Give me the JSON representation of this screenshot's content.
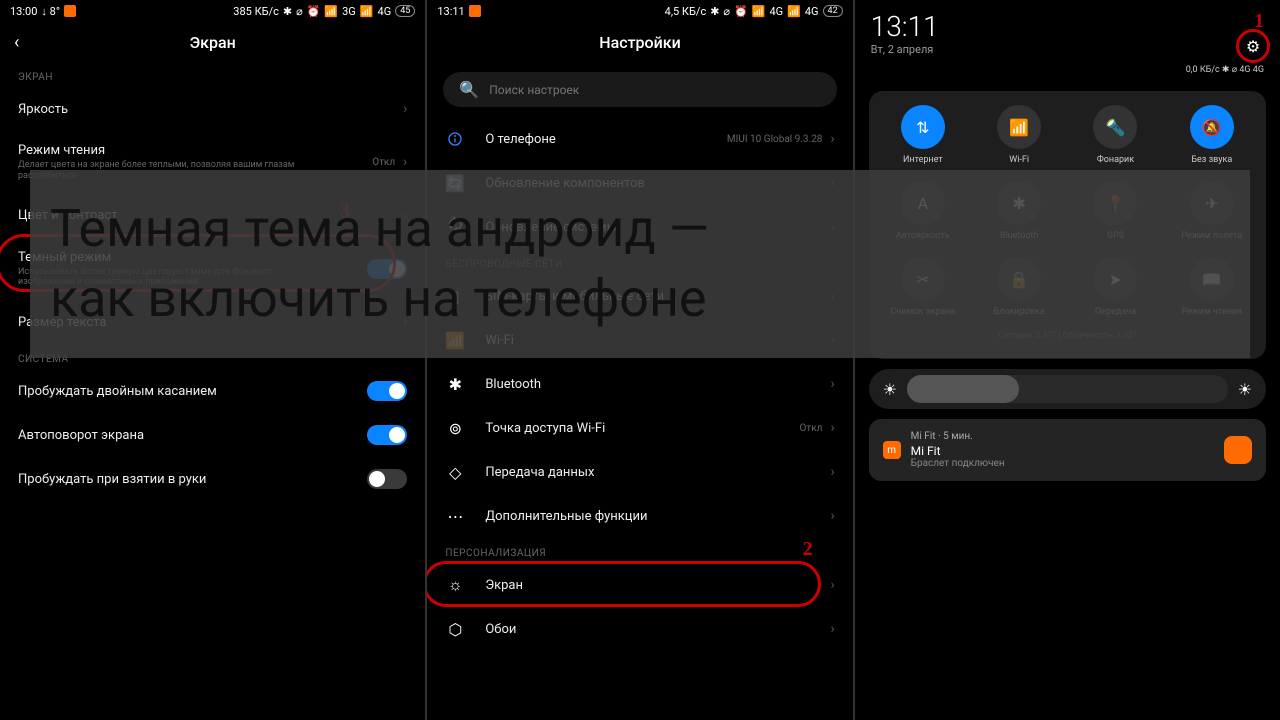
{
  "overlay": {
    "line1": "Темная тема на андроид —",
    "line2": "как включить на телефоне"
  },
  "annotations": {
    "n1": "1",
    "n2": "2",
    "n3": "3"
  },
  "panel1": {
    "status": {
      "time": "13:00",
      "temp": "↓ 8°",
      "speed": "385 КБ/с",
      "net": "3G",
      "net2": "4G",
      "batt": "45"
    },
    "title": "Экран",
    "sect1": "ЭКРАН",
    "brightness": "Яркость",
    "reading": {
      "label": "Режим чтения",
      "sub": "Делает цвета на экране более теплыми, позволяя вашим глазам расслабиться",
      "value": "Откл"
    },
    "color": "Цвет и контраст",
    "dark": {
      "label": "Темный режим",
      "sub": "Использовать более темную цветовую гамму для фонового изображения и совместимых приложений"
    },
    "fontsize": "Размер текста",
    "sect2": "СИСТЕМА",
    "doubletap": "Пробуждать двойным касанием",
    "autorotate": "Автоповорот экрана",
    "raise": "Пробуждать при взятии в руки"
  },
  "panel2": {
    "status": {
      "time": "13:11",
      "speed": "4,5 КБ/с",
      "net": "4G",
      "net2": "4G",
      "batt": "42"
    },
    "title": "Настройки",
    "search_ph": "Поиск настроек",
    "about": {
      "label": "О телефоне",
      "value": "MIUI 10 Global 9.3.28"
    },
    "update": "Обновление компонентов",
    "backup": "Обновление системы",
    "sect_wireless": "БЕСПРОВОДНЫЕ СЕТИ",
    "sim": "SIM-карты и мобильные сети",
    "wifi": "Wi-Fi",
    "bt": "Bluetooth",
    "hotspot": {
      "label": "Точка доступа Wi-Fi",
      "value": "Откл"
    },
    "data": "Передача данных",
    "more": "Дополнительные функции",
    "sect_pers": "ПЕРСОНАЛИЗАЦИЯ",
    "screen": "Экран",
    "wallpaper": "Обои"
  },
  "panel3": {
    "clock": "13:11",
    "date": "Вт, 2 апреля",
    "meta": "0,0 КБ/с ✱ ⌀ 4G 4G",
    "tiles": [
      {
        "label": "Интернет",
        "active": true,
        "icon": "↑↓"
      },
      {
        "label": "Wi-Fi",
        "active": false,
        "icon": "wifi"
      },
      {
        "label": "Фонарик",
        "active": false,
        "icon": "flash"
      },
      {
        "label": "Без звука",
        "active": true,
        "icon": "mute"
      },
      {
        "label": "Автояркость",
        "active": false,
        "icon": "bright"
      },
      {
        "label": "Bluetooth",
        "active": false,
        "icon": "bt"
      },
      {
        "label": "GPS",
        "active": false,
        "icon": "gps"
      },
      {
        "label": "Режим полета",
        "active": false,
        "icon": "plane"
      },
      {
        "label": "Снимок экрана",
        "active": false,
        "icon": "shot"
      },
      {
        "label": "Блокировка",
        "active": false,
        "icon": "lock"
      },
      {
        "label": "Передача",
        "active": false,
        "icon": "send"
      },
      {
        "label": "Режим чтения",
        "active": false,
        "icon": "read"
      }
    ],
    "weather": "Сегодня 2.37° | Облачность 3.35°",
    "notif": {
      "app": "Mi Fit · 5 мин.",
      "title": "Mi Fit",
      "sub": "Браслет подключен"
    }
  }
}
